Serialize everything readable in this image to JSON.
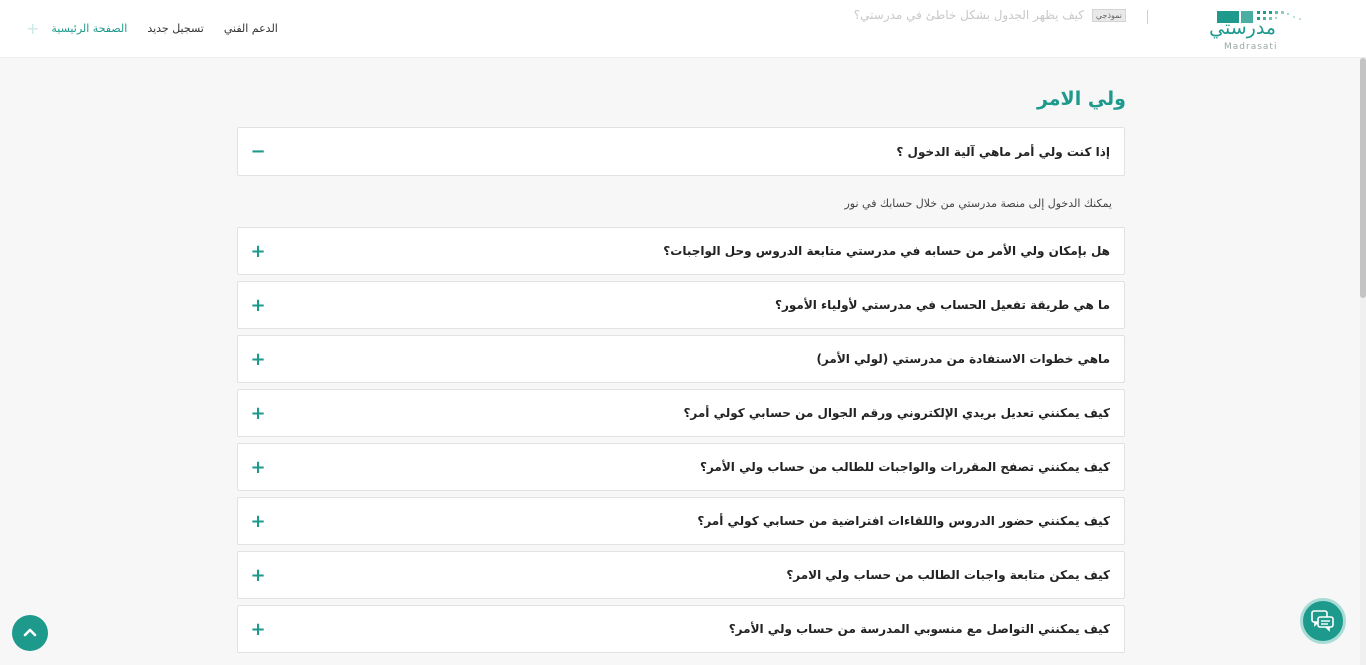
{
  "header": {
    "logo": {
      "arabic": "مدرستي",
      "latin": "Madrasati"
    },
    "nav": [
      {
        "label": "الصفحة الرئيسية",
        "active": true
      },
      {
        "label": "تسجيل جديد",
        "active": false
      },
      {
        "label": "الدعم الفني",
        "active": false
      }
    ],
    "ticker": {
      "tag": "نموذجي",
      "text": "كيف يظهر الجدول بشكل خاطئ في مدرستي؟"
    }
  },
  "section": {
    "title": "ولي الامر"
  },
  "faq": [
    {
      "question": "إذا كنت ولي أمر ماهي آلية الدخول ؟",
      "expanded": true,
      "answer": "يمكنك الدخول إلى منصة مدرستي من خلال حسابك في نور",
      "icon": "−"
    },
    {
      "question": "هل بإمكان ولي الأمر من حسابه في مدرستي متابعة الدروس وحل الواجبات؟",
      "expanded": false,
      "icon": "+"
    },
    {
      "question": "ما هي طريقة تفعيل الحساب في مدرستي لأولياء الأمور؟",
      "expanded": false,
      "icon": "+"
    },
    {
      "question": "ماهي خطوات الاستفادة من مدرستي (لولي الأمر)",
      "expanded": false,
      "icon": "+"
    },
    {
      "question": "كيف يمكنني تعديل بريدي الإلكتروني ورقم الجوال من حسابي كولي أمر؟",
      "expanded": false,
      "icon": "+"
    },
    {
      "question": "كيف يمكنني تصفح المقررات والواجبات للطالب من حساب ولي الأمر؟",
      "expanded": false,
      "icon": "+"
    },
    {
      "question": "كيف يمكنني حضور الدروس واللقاءات افتراضية من حسابي كولي أمر؟",
      "expanded": false,
      "icon": "+"
    },
    {
      "question": "كيف يمكن متابعة واجبات الطالب من حساب ولي الامر؟",
      "expanded": false,
      "icon": "+"
    },
    {
      "question": "كيف يمكنني التواصل مع منسوبي المدرسة من حساب ولي الأمر؟",
      "expanded": false,
      "icon": "+"
    }
  ],
  "colors": {
    "brand": "#1d9a8c",
    "background": "#f7f7f7"
  },
  "icons": {
    "scroll_top": "chevron-up-icon",
    "chat": "chat-bubbles-icon"
  }
}
